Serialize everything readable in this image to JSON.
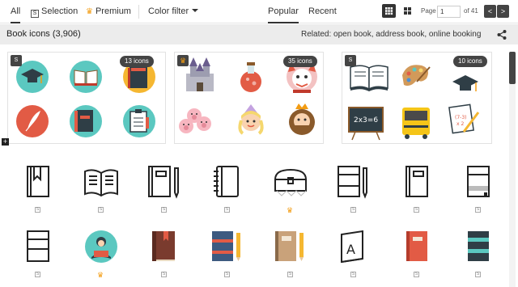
{
  "filters": {
    "all": "All",
    "selection": "Selection",
    "selection_badge": "S",
    "premium": "Premium",
    "color_filter": "Color filter",
    "popular": "Popular",
    "recent": "Recent"
  },
  "pager": {
    "page_label": "Page",
    "page_value": "1",
    "of_label": "of 41",
    "prev": "<",
    "next": ">"
  },
  "info": {
    "title": "Book icons (3,906)",
    "related": "Related: open book, address book, online booking"
  },
  "cards": [
    {
      "badge": "S",
      "count": "13 icons"
    },
    {
      "badge": "crown",
      "count": "35 icons"
    },
    {
      "badge": "S",
      "count": "10 icons"
    }
  ],
  "card_text": {
    "math": "2x3=6"
  },
  "icon_grid": {
    "row1": [
      "S",
      "S",
      "S",
      "S",
      "crown",
      "S",
      "S",
      "S"
    ],
    "row2": [
      "S",
      "crown",
      "S",
      "S",
      "S",
      "S",
      "S",
      "S"
    ],
    "letter_a": "A",
    "free_mark": "S",
    "premium_mark": "♛"
  },
  "colors": {
    "accent": "#f39c12",
    "dark": "#333333",
    "teal": "#5bc8c0",
    "red": "#e25b45"
  }
}
